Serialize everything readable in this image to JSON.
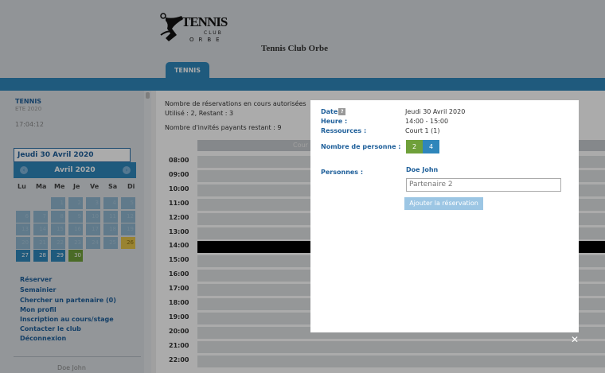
{
  "header": {
    "logo": {
      "word": "TENNIS",
      "club": "CLUB",
      "orbe": "ORBE"
    },
    "site_title": "Tennis Club Orbe",
    "tab": "TENNIS"
  },
  "sidebar": {
    "title": "TENNIS",
    "season": "ETE 2020",
    "time": "17:04:12",
    "selected_date": "Jeudi 30 Avril 2020",
    "calendar": {
      "month": "Avril 2020",
      "prev_icon": "‹",
      "next_icon": "›",
      "weekdays": [
        "Lu",
        "Ma",
        "Me",
        "Je",
        "Ve",
        "Sa",
        "Di"
      ],
      "days": [
        {
          "d": "1"
        },
        {
          "d": "2"
        },
        {
          "d": "3"
        },
        {
          "d": "4"
        },
        {
          "d": "5"
        },
        {
          "d": "6"
        },
        {
          "d": "7"
        },
        {
          "d": "8"
        },
        {
          "d": "9"
        },
        {
          "d": "10"
        },
        {
          "d": "11"
        },
        {
          "d": "12"
        },
        {
          "d": "13"
        },
        {
          "d": "14"
        },
        {
          "d": "15"
        },
        {
          "d": "16"
        },
        {
          "d": "17"
        },
        {
          "d": "18"
        },
        {
          "d": "19"
        },
        {
          "d": "20"
        },
        {
          "d": "21"
        },
        {
          "d": "22"
        },
        {
          "d": "23"
        },
        {
          "d": "24"
        },
        {
          "d": "25"
        },
        {
          "d": "26",
          "state": "today"
        },
        {
          "d": "27",
          "state": "available"
        },
        {
          "d": "28",
          "state": "available"
        },
        {
          "d": "29",
          "state": "available"
        },
        {
          "d": "30",
          "state": "selected"
        }
      ]
    },
    "menu": [
      "Réserver",
      "Semainier",
      "Chercher un partenaire (0)",
      "Mon profil",
      "Inscription au cours/stage",
      "Contacter le club",
      "Déconnexion"
    ],
    "user": "Doe John"
  },
  "main": {
    "info_line1": "Nombre de réservations en cours autorisées",
    "info_line2": "Utilisé : 2, Restant : 3",
    "info_line3": "Nombre d'invités payants restant : 9",
    "court_header": "Cour",
    "hours": [
      "08:00",
      "09:00",
      "10:00",
      "11:00",
      "12:00",
      "13:00",
      "14:00",
      "15:00",
      "16:00",
      "17:00",
      "18:00",
      "19:00",
      "20:00",
      "21:00",
      "22:00"
    ],
    "booked_hour": "14:00"
  },
  "modal": {
    "date_label": "Date",
    "date_value": "Jeudi 30 Avril 2020",
    "heure_label": "Heure :",
    "heure_value": "14:00 - 15:00",
    "ressources_label": "Ressources :",
    "ressources_value": "Court 1 (1)",
    "nb_label": "Nombre de personne :",
    "nb_options": [
      "2",
      "4"
    ],
    "nb_selected": "2",
    "personnes_label": "Personnes :",
    "person1": "Doe John",
    "partner_placeholder": "Partenaire 2",
    "add_button": "Ajouter la réservation",
    "close_icon": "✕"
  },
  "colors": {
    "accent": "#2f86bb",
    "link": "#1e5f9a",
    "today": "#e4c34a",
    "selected": "#6fa03a"
  }
}
